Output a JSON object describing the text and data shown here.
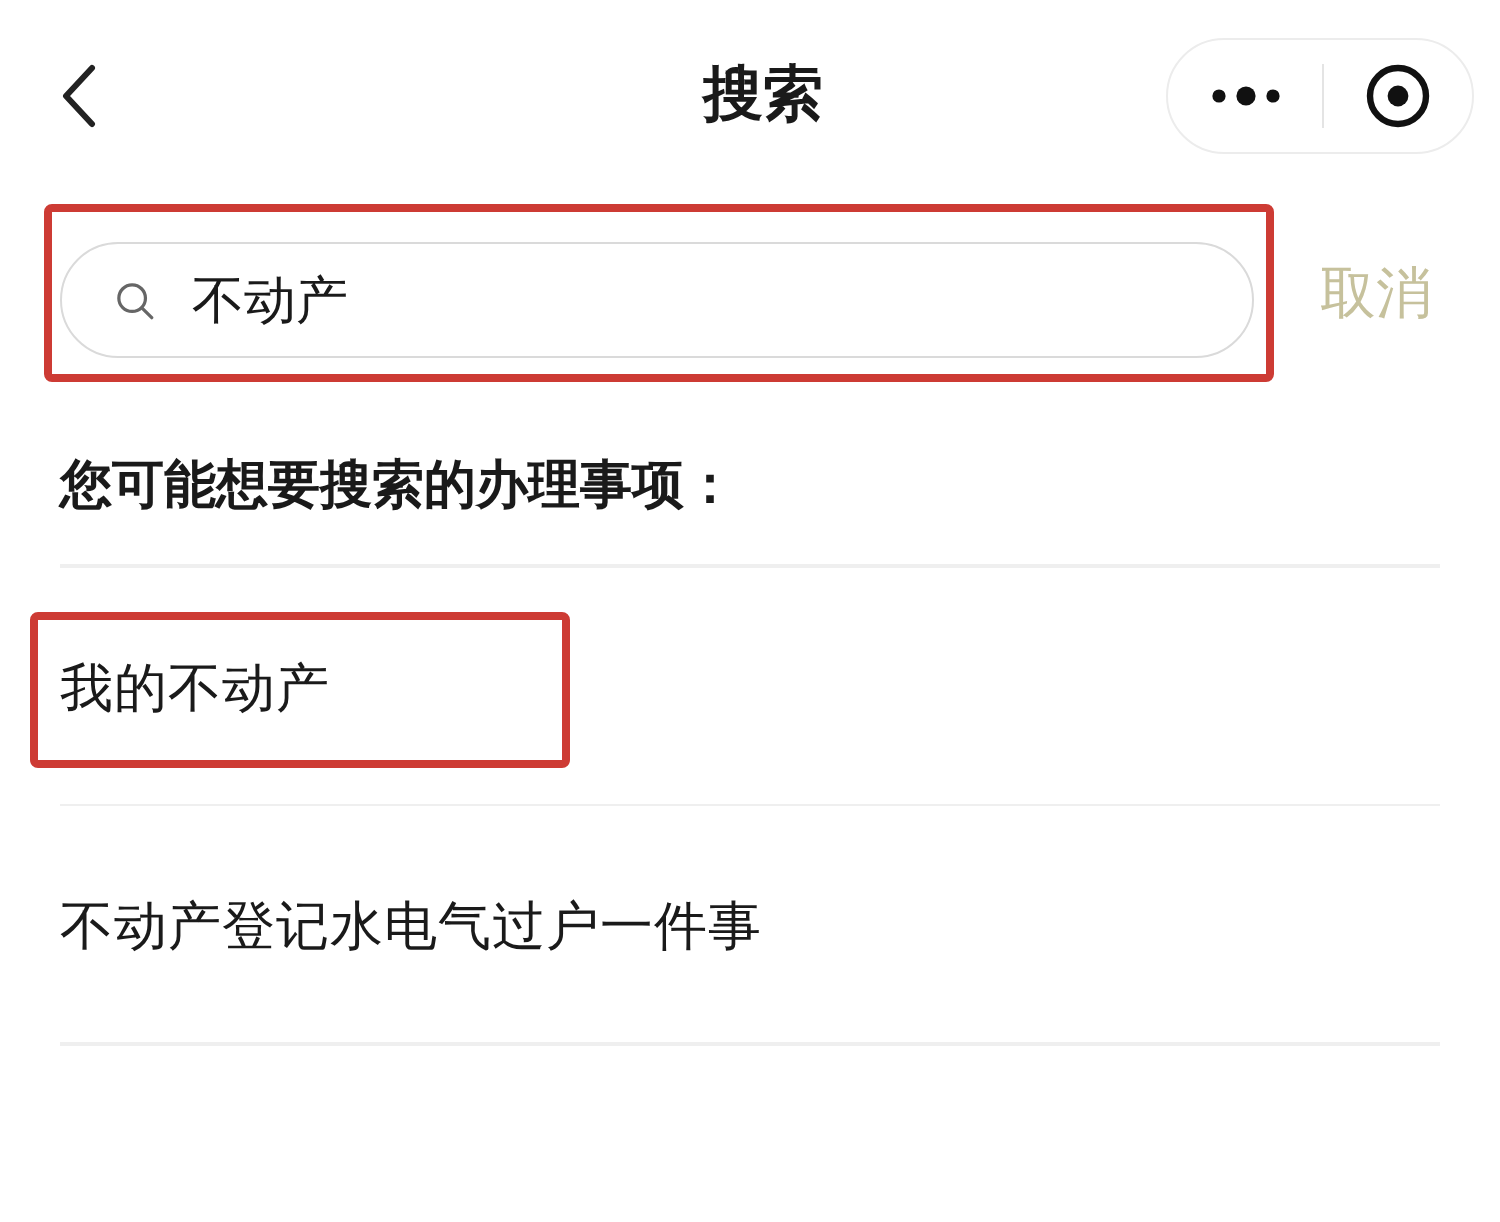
{
  "nav_bar": {
    "title": "搜索"
  },
  "search": {
    "value": "不动产",
    "highlighted": true,
    "cancel": "取消"
  },
  "suggestions": {
    "heading": "您可能想要搜索的办理事项：",
    "items": [
      {
        "label": "我的不动产",
        "highlighted": true
      },
      {
        "label": "不动产登记水电气过户一件事",
        "highlighted": false
      }
    ]
  }
}
